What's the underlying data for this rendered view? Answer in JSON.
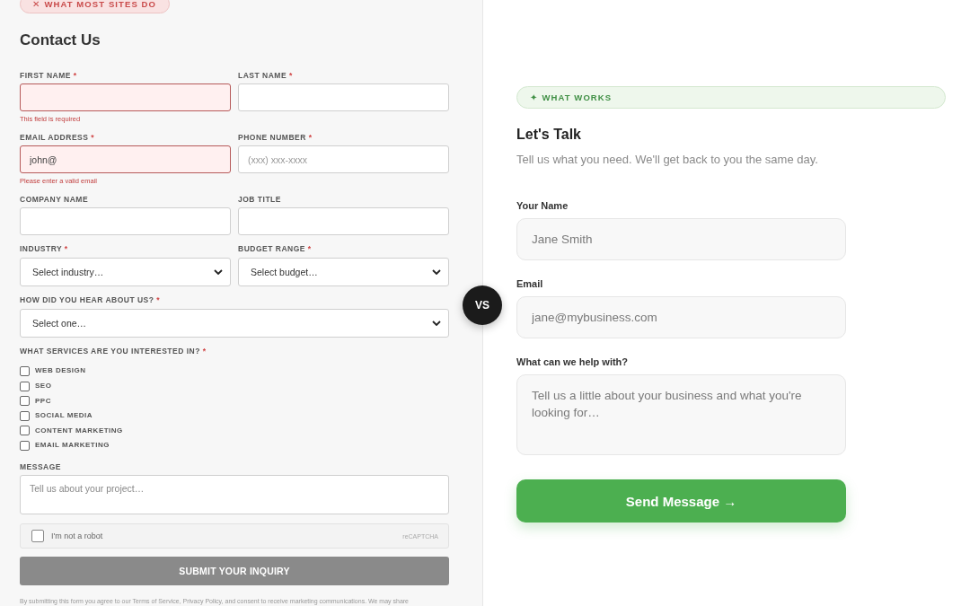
{
  "left_panel": {
    "badge": {
      "icon": "✕",
      "label": "WHAT MOST SITES DO"
    },
    "title": "Contact Us",
    "rows": [
      {
        "fields": [
          {
            "kind": "text",
            "label": "FIRST NAME",
            "required_mark": "*",
            "invalid": true,
            "error": "This field is required"
          },
          {
            "kind": "text",
            "label": "LAST NAME",
            "required_mark": "*",
            "invalid": false
          }
        ]
      },
      {
        "fields": [
          {
            "kind": "text",
            "label": "EMAIL ADDRESS",
            "required_mark": "*",
            "invalid": true,
            "value": "john@",
            "error": "Please enter a valid email"
          },
          {
            "kind": "text",
            "label": "PHONE NUMBER",
            "required_mark": "*",
            "invalid": false,
            "placeholder": "(xxx) xxx-xxxx"
          }
        ]
      },
      {
        "fields": [
          {
            "kind": "text",
            "label": "COMPANY NAME",
            "invalid": false
          },
          {
            "kind": "text",
            "label": "JOB TITLE",
            "invalid": false
          }
        ]
      },
      {
        "fields": [
          {
            "kind": "select",
            "label": "INDUSTRY",
            "required_mark": "*",
            "value": "Select industry…"
          },
          {
            "kind": "select",
            "label": "BUDGET RANGE",
            "required_mark": "*",
            "value": "Select budget…"
          }
        ]
      },
      {
        "fields": [
          {
            "kind": "select",
            "label": "HOW DID YOU HEAR ABOUT US?",
            "required_mark": "*",
            "value": "Select one…"
          }
        ]
      },
      {
        "fields": [
          {
            "kind": "checkboxes",
            "label": "WHAT SERVICES ARE YOU INTERESTED IN?",
            "required_mark": "*",
            "options": [
              {
                "label": "WEB DESIGN",
                "checked": false
              },
              {
                "label": "SEO",
                "checked": false
              },
              {
                "label": "PPC",
                "checked": false
              },
              {
                "label": "SOCIAL MEDIA",
                "checked": false
              },
              {
                "label": "CONTENT MARKETING",
                "checked": false
              },
              {
                "label": "EMAIL MARKETING",
                "checked": false
              }
            ]
          }
        ]
      },
      {
        "fields": [
          {
            "kind": "textarea",
            "label": "MESSAGE",
            "placeholder": "Tell us about your project…"
          }
        ]
      }
    ],
    "captcha": {
      "label": "I'm not a robot",
      "checked": false,
      "brand": "reCAPTCHA"
    },
    "submit_button": {
      "label": "SUBMIT YOUR INQUIRY"
    },
    "disclaimer": "By submitting this form you agree to our Terms of Service, Privacy Policy, and consent to receive marketing communications. We may share"
  },
  "comparison_marker": {
    "label": "VS"
  },
  "right_panel": {
    "badge": {
      "icon": "✦",
      "label": "WHAT WORKS"
    },
    "title": "Let's Talk",
    "subtitle": "Tell us what you need. We'll get back to you the same day.",
    "fields": [
      {
        "kind": "text",
        "label": "Your Name",
        "placeholder": "Jane Smith"
      },
      {
        "kind": "text",
        "label": "Email",
        "placeholder": "jane@mybusiness.com"
      },
      {
        "kind": "textarea",
        "label": "What can we help with?",
        "placeholder": "Tell us a little about your business and what you're looking for…"
      }
    ],
    "submit_button": {
      "label": "Send Message →"
    }
  }
}
